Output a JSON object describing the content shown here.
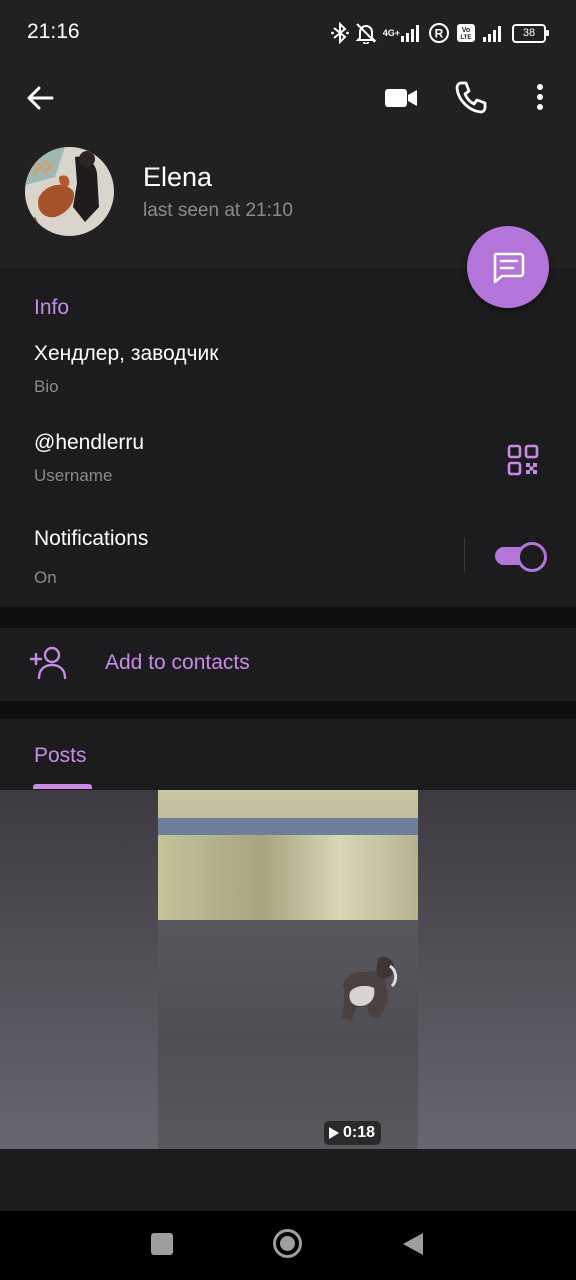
{
  "status_bar": {
    "time": "21:16",
    "network_label": "4G+",
    "volte_label": "Vo LTE",
    "roaming_label": "R",
    "battery": "38"
  },
  "header": {
    "name": "Elena",
    "last_seen": "last seen at 21:10"
  },
  "info": {
    "heading": "Info",
    "bio": "Хендлер, заводчик",
    "bio_label": "Bio",
    "username": "@hendlerru",
    "username_label": "Username",
    "notifications": "Notifications",
    "notifications_state": "On",
    "notifications_enabled": true
  },
  "contacts": {
    "add_label": "Add to contacts"
  },
  "posts": {
    "tab_label": "Posts",
    "video_duration": "0:18"
  },
  "colors": {
    "accent": "#c78be6",
    "fab": "#b375d9",
    "background": "#0f0f10",
    "surface": "#1c1c1e",
    "header": "#212121",
    "muted_text": "#8b8b8f"
  },
  "icons": {
    "back": "arrow-left-icon",
    "video": "video-camera-icon",
    "call": "phone-icon",
    "more": "more-vertical-icon",
    "message": "message-icon",
    "qr": "qr-code-icon",
    "add_contact": "add-person-icon",
    "play": "play-icon"
  }
}
